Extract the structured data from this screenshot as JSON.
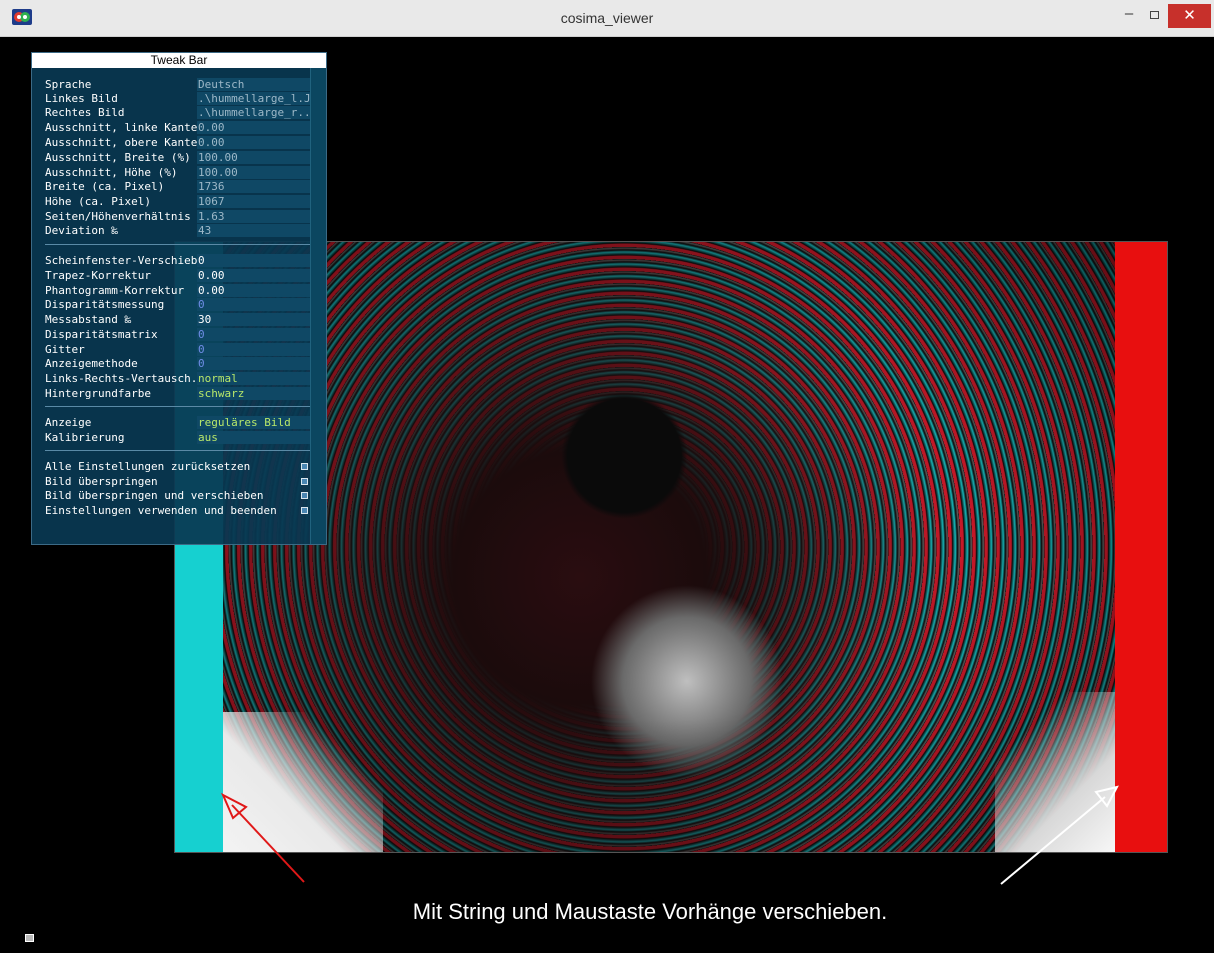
{
  "window": {
    "title": "cosima_viewer",
    "minimize_glyph": "–",
    "close_glyph": "✕",
    "accent_close": "#c7302b"
  },
  "tweak_bar": {
    "title": "Tweak Bar",
    "group1": [
      {
        "label": "Sprache",
        "value": "Deutsch",
        "style": "grey"
      },
      {
        "label": "Linkes Bild",
        "value": ".\\hummellarge_l.J..",
        "style": "grey"
      },
      {
        "label": "Rechtes Bild",
        "value": ".\\hummellarge_r...",
        "style": "grey"
      },
      {
        "label": "Ausschnitt, linke Kante..",
        "value": "0.00",
        "style": "grey"
      },
      {
        "label": "Ausschnitt, obere Kante..",
        "value": "0.00",
        "style": "grey"
      },
      {
        "label": "Ausschnitt, Breite (%)",
        "value": "100.00",
        "style": "grey"
      },
      {
        "label": "Ausschnitt, Höhe (%)",
        "value": "100.00",
        "style": "grey"
      },
      {
        "label": "Breite (ca. Pixel)",
        "value": "1736",
        "style": "grey"
      },
      {
        "label": "Höhe (ca. Pixel)",
        "value": "1067",
        "style": "grey"
      },
      {
        "label": "Seiten/Höhenverhältnis",
        "value": "1.63",
        "style": "grey"
      },
      {
        "label": "Deviation ‰",
        "value": "43",
        "style": "grey"
      }
    ],
    "group2": [
      {
        "label": "Scheinfenster-Verschieb..",
        "value": "0",
        "style": "white"
      },
      {
        "label": "Trapez-Korrektur",
        "value": "0.00",
        "style": "white"
      },
      {
        "label": "Phantogramm-Korrektur",
        "value": "0.00",
        "style": "white"
      },
      {
        "label": "Disparitätsmessung",
        "value": "0",
        "style": "blue"
      },
      {
        "label": "Messabstand ‰",
        "value": "30",
        "style": "white"
      },
      {
        "label": "Disparitätsmatrix",
        "value": "0",
        "style": "blue"
      },
      {
        "label": "Gitter",
        "value": "0",
        "style": "blue"
      },
      {
        "label": "Anzeigemethode",
        "value": "0",
        "style": "blue"
      },
      {
        "label": "Links-Rechts-Vertausch..",
        "value": "normal",
        "style": "green"
      },
      {
        "label": "Hintergrundfarbe",
        "value": "schwarz",
        "style": "green"
      }
    ],
    "group3": [
      {
        "label": "Anzeige",
        "value": "reguläres Bild",
        "style": "green"
      },
      {
        "label": "Kalibrierung",
        "value": "aus",
        "style": "green"
      }
    ],
    "buttons": [
      {
        "label": "Alle Einstellungen zurücksetzen"
      },
      {
        "label": "Bild überspringen"
      },
      {
        "label": "Bild überspringen und verschieben"
      },
      {
        "label": "Einstellungen verwenden und beenden"
      }
    ]
  },
  "caption": "Mit String und Maustaste Vorhänge verschieben.",
  "colors": {
    "curtain_left": "#16d0d0",
    "curtain_right": "#e80f0f",
    "arrow_left": "#e01818",
    "arrow_right": "#ffffff",
    "tweakbar_bg": "#093852"
  }
}
